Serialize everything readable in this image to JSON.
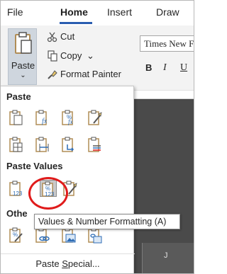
{
  "tabs": [
    "File",
    "Home",
    "Insert",
    "Draw"
  ],
  "ribbon": {
    "paste_label": "Paste",
    "paste_chevron": "⌄",
    "cut_label": "Cut",
    "copy_label": "Copy",
    "copy_chevron": "⌄",
    "format_painter_label": "Format Painter",
    "font_name": "Times New F",
    "bold": "B",
    "italic": "I",
    "underline": "U"
  },
  "menu": {
    "paste_header": "Paste",
    "paste_values_header": "Paste Values",
    "other_header": "Othe",
    "paste_special_prefix": "Paste ",
    "paste_special_underlined": "S",
    "paste_special_suffix": "pecial..."
  },
  "tooltip": "Values & Number Formatting (A)",
  "sheet": {
    "column_label": "J"
  },
  "colors": {
    "accent": "#2a5db0",
    "highlight_circle": "#e01b1b",
    "clipboard_brown": "#b08d57",
    "icon_blue": "#2f6db5"
  }
}
